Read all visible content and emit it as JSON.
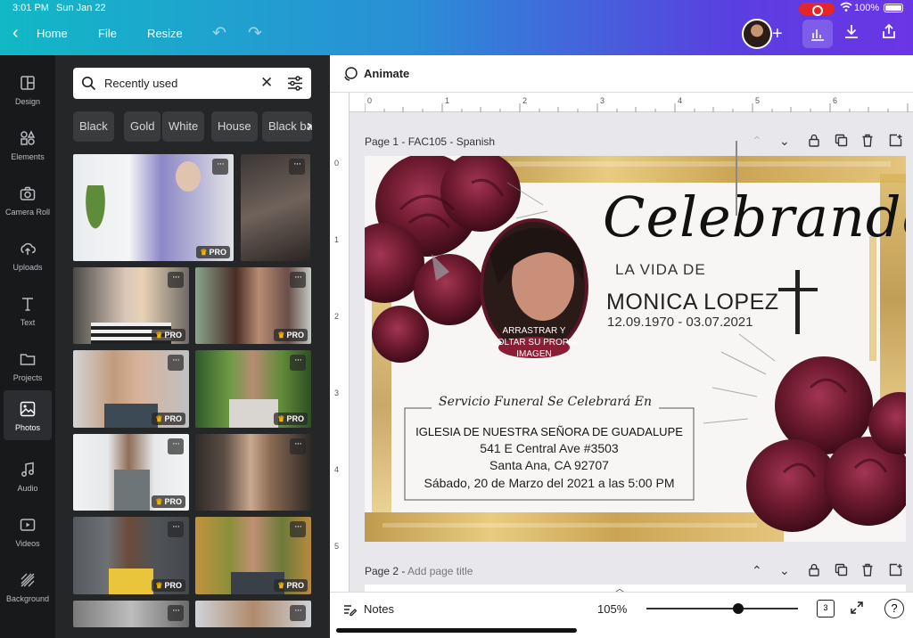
{
  "status": {
    "time": "3:01 PM",
    "date": "Sun Jan 22",
    "battery": "100%"
  },
  "topbar": {
    "home": "Home",
    "file": "File",
    "resize": "Resize"
  },
  "rail": {
    "items": [
      {
        "label": "Design",
        "icon": "design-icon"
      },
      {
        "label": "Elements",
        "icon": "elements-icon"
      },
      {
        "label": "Camera Roll",
        "icon": "camera-icon"
      },
      {
        "label": "Uploads",
        "icon": "upload-icon"
      },
      {
        "label": "Text",
        "icon": "text-icon"
      },
      {
        "label": "Projects",
        "icon": "folder-icon"
      },
      {
        "label": "Photos",
        "icon": "photos-icon"
      },
      {
        "label": "Audio",
        "icon": "music-icon"
      },
      {
        "label": "Videos",
        "icon": "video-icon"
      },
      {
        "label": "Background",
        "icon": "background-icon"
      }
    ],
    "active": "Photos"
  },
  "panel": {
    "search_value": "Recently used",
    "chips": [
      "Black",
      "Gold",
      "White",
      "House",
      "Black ba"
    ],
    "pro_label": "PRO",
    "more_label": "···"
  },
  "editor": {
    "animate": "Animate",
    "ruler_h": [
      "0",
      "1",
      "2",
      "3",
      "4",
      "5",
      "6"
    ],
    "ruler_v": [
      "0",
      "1",
      "2",
      "3",
      "4",
      "5"
    ],
    "page1_label": "Page 1 - FAC105 - Spanish",
    "page2_prefix": "Page 2 - ",
    "page2_placeholder": "Add page title"
  },
  "card": {
    "script_title": "Celebrando",
    "subtitle": "LA VIDA DE",
    "name": "MONICA LOPEZ",
    "dates": "12.09.1970 - 03.07.2021",
    "photo_caption": [
      "ARRASTRAR Y",
      "SOLTAR SU PROPIA",
      "IMAGEN"
    ],
    "service_heading": "Servicio Funeral Se Celebrará En",
    "church": "IGLESIA DE NUESTRA SEÑORA DE GUADALUPE",
    "address1": "541 E Central Ave #3503",
    "address2": "Santa Ana, CA 92707",
    "datetime": "Sábado, 20 de Marzo del 2021 a las 5:00 PM"
  },
  "bottom": {
    "notes": "Notes",
    "zoom": "105%",
    "pages": "3",
    "help": "?"
  },
  "colors": {
    "accent_start": "#12b8c6",
    "accent_end": "#6b35e6",
    "burgundy": "#6d1a2f",
    "gold": "#c9a24a"
  }
}
